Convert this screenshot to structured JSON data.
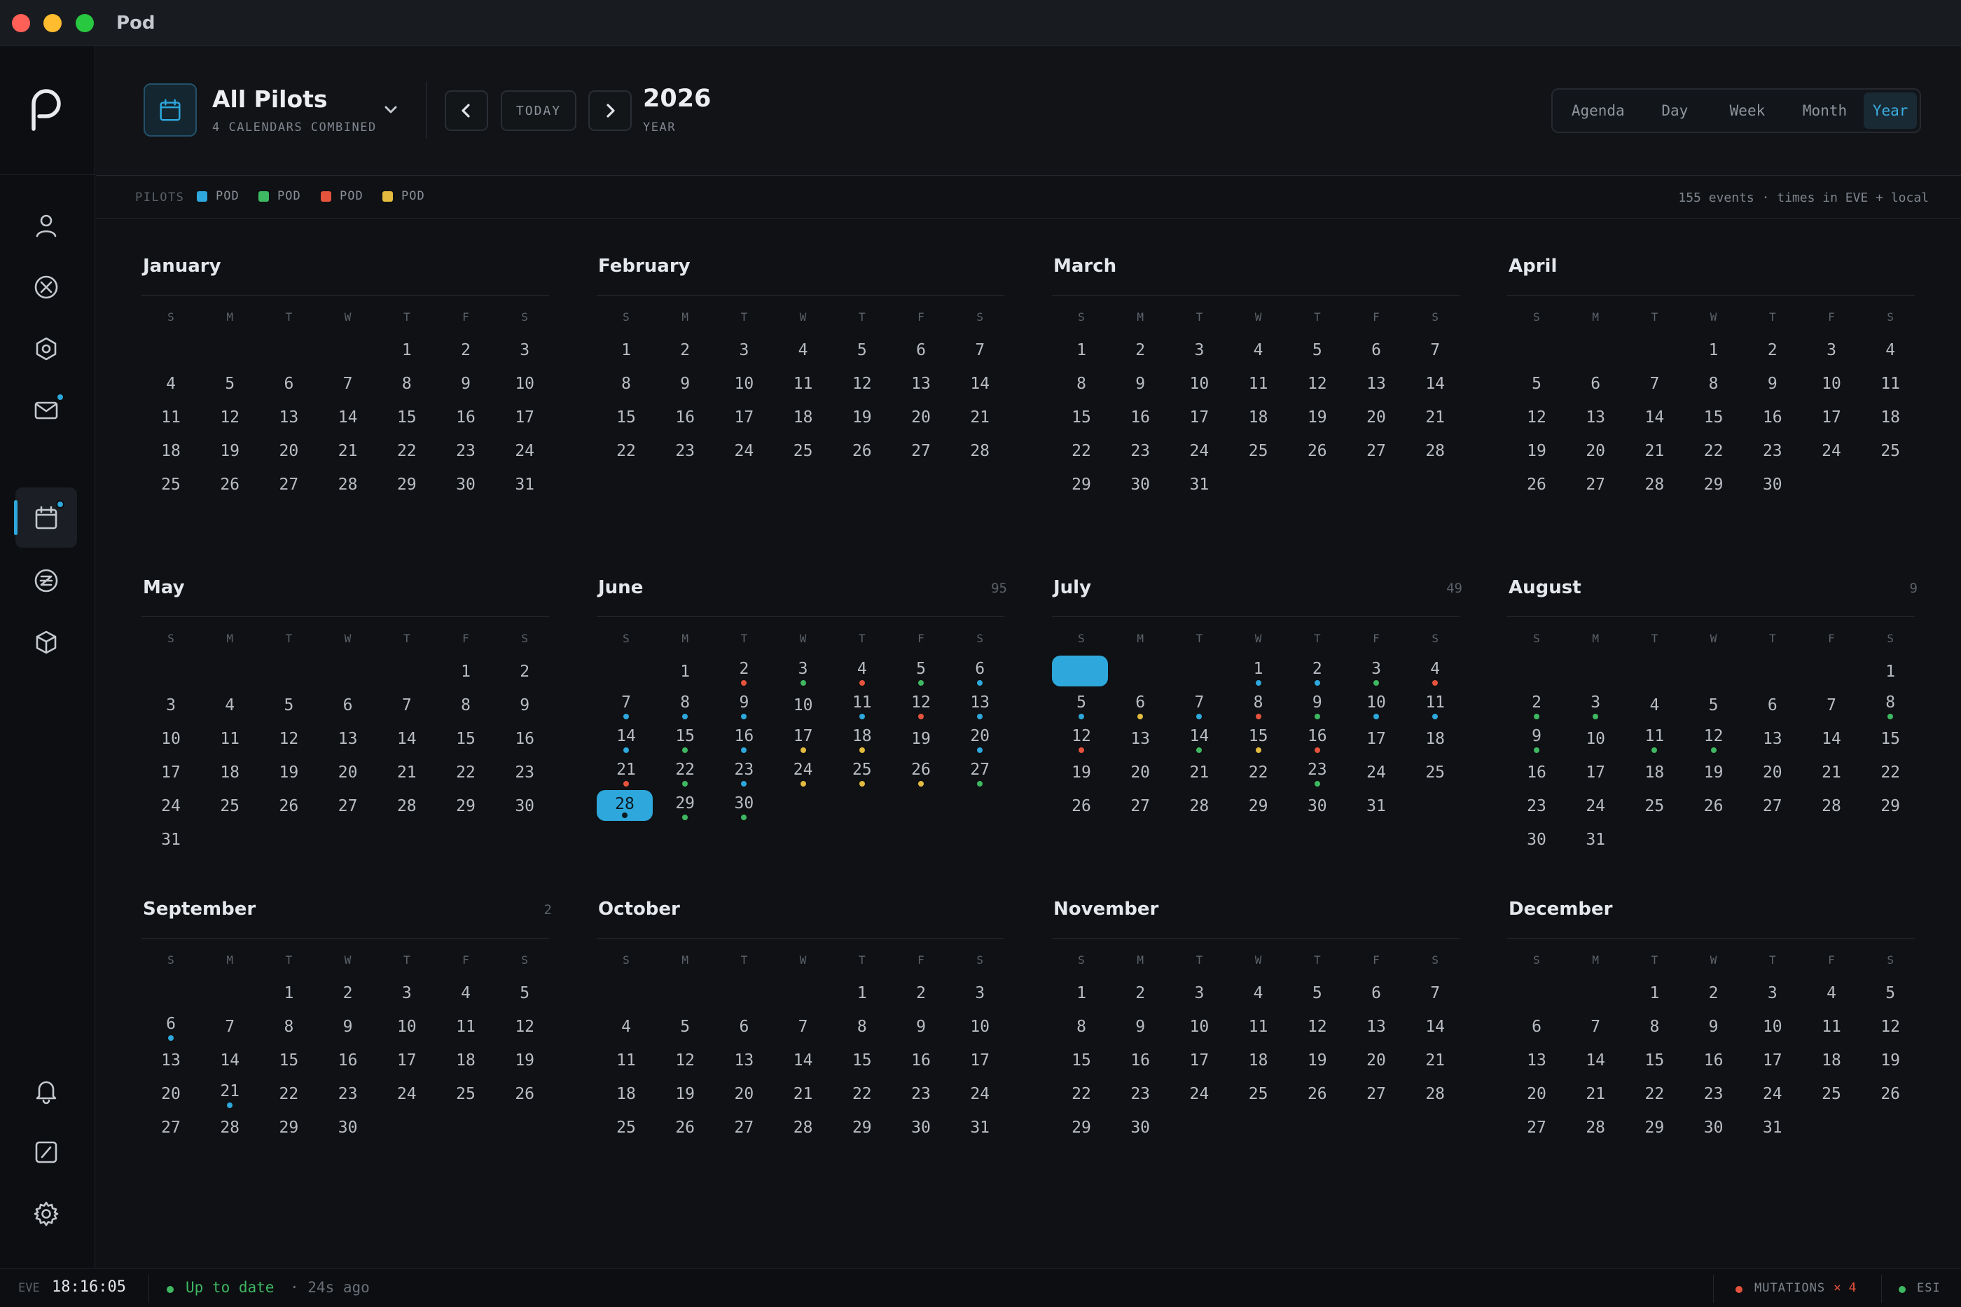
{
  "app": {
    "title": "Pod"
  },
  "header": {
    "calendar_title": "All Pilots",
    "calendar_subtitle": "4 CALENDARS COMBINED",
    "today_label": "TODAY",
    "period_title": "2026",
    "period_subtitle": "YEAR",
    "views": [
      "Agenda",
      "Day",
      "Week",
      "Month",
      "Year"
    ],
    "active_view": "Year"
  },
  "legend": {
    "label": "PILOTS",
    "pilots": [
      {
        "name": "POD",
        "color": "#2ea8dc"
      },
      {
        "name": "POD",
        "color": "#3fb862"
      },
      {
        "name": "POD",
        "color": "#e5533d"
      },
      {
        "name": "POD",
        "color": "#e3bb3f"
      }
    ],
    "summary": "155 events · times in EVE + local"
  },
  "weekdays": [
    "S",
    "M",
    "T",
    "W",
    "T",
    "F",
    "S"
  ],
  "months": [
    {
      "name": "January",
      "count": "",
      "start": 4,
      "days": 31,
      "today": null,
      "blank_today": false,
      "events": {}
    },
    {
      "name": "February",
      "count": "",
      "start": 0,
      "days": 28,
      "today": null,
      "blank_today": false,
      "events": {}
    },
    {
      "name": "March",
      "count": "",
      "start": 0,
      "days": 31,
      "today": null,
      "blank_today": false,
      "events": {}
    },
    {
      "name": "April",
      "count": "",
      "start": 3,
      "days": 30,
      "today": null,
      "blank_today": false,
      "events": {}
    },
    {
      "name": "May",
      "count": "",
      "start": 5,
      "days": 31,
      "today": null,
      "blank_today": false,
      "events": {}
    },
    {
      "name": "June",
      "count": "95",
      "start": 1,
      "days": 30,
      "today": 28,
      "blank_today": false,
      "events": {
        "2": "red",
        "3": "green",
        "4": "red",
        "5": "green",
        "6": "blue",
        "7": "blue",
        "8": "blue",
        "9": "blue",
        "11": "blue",
        "12": "red",
        "13": "blue",
        "14": "blue",
        "15": "green",
        "16": "blue",
        "17": "yellow",
        "18": "yellow",
        "20": "blue",
        "21": "red",
        "22": "green",
        "23": "blue",
        "24": "yellow",
        "25": "yellow",
        "26": "yellow",
        "27": "green",
        "28": "dark",
        "29": "green",
        "30": "green"
      }
    },
    {
      "name": "July",
      "count": "49",
      "start": 3,
      "days": 31,
      "today": null,
      "blank_today": true,
      "events": {
        "1": "blue",
        "2": "blue",
        "3": "green",
        "4": "red",
        "5": "blue",
        "6": "yellow",
        "7": "blue",
        "8": "red",
        "9": "green",
        "10": "blue",
        "11": "blue",
        "12": "red",
        "14": "green",
        "15": "yellow",
        "16": "red",
        "23": "green"
      }
    },
    {
      "name": "August",
      "count": "9",
      "start": 6,
      "days": 31,
      "today": null,
      "blank_today": false,
      "events": {
        "2": "green",
        "3": "green",
        "8": "green",
        "9": "green",
        "11": "green",
        "12": "green"
      }
    },
    {
      "name": "September",
      "count": "2",
      "start": 2,
      "days": 30,
      "today": null,
      "blank_today": false,
      "events": {
        "6": "blue",
        "21": "blue"
      }
    },
    {
      "name": "October",
      "count": "",
      "start": 4,
      "days": 31,
      "today": null,
      "blank_today": false,
      "events": {}
    },
    {
      "name": "November",
      "count": "",
      "start": 0,
      "days": 30,
      "today": null,
      "blank_today": false,
      "events": {}
    },
    {
      "name": "December",
      "count": "",
      "start": 2,
      "days": 31,
      "today": null,
      "blank_today": false,
      "events": {}
    }
  ],
  "colors": {
    "blue": "#2ea8dc",
    "green": "#3fb862",
    "red": "#e5533d",
    "yellow": "#e3bb3f",
    "dark": "#0c1a22"
  },
  "status": {
    "eve_label": "EVE",
    "eve_clock": "18:16:05",
    "sync_status": "Up to date",
    "sync_ago": "· 24s ago",
    "mutations_label": "MUTATIONS",
    "mutations_count": "× 4",
    "esi_label": "ESI"
  }
}
